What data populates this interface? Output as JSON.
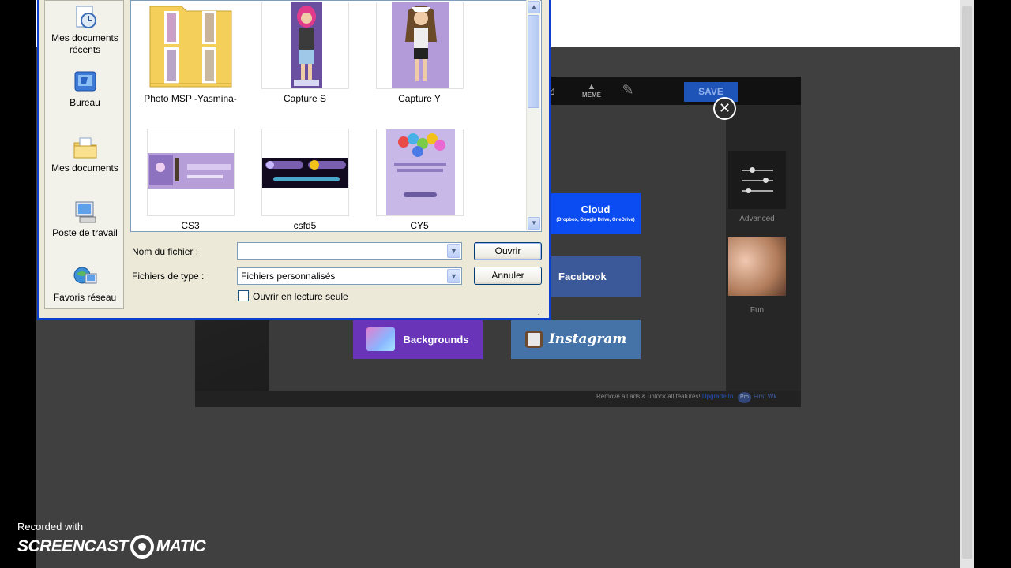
{
  "dialog": {
    "places": [
      {
        "label": "Mes documents récents",
        "icon": "recent-documents-icon"
      },
      {
        "label": "Bureau",
        "icon": "desktop-icon"
      },
      {
        "label": "Mes documents",
        "icon": "my-documents-icon"
      },
      {
        "label": "Poste de travail",
        "icon": "my-computer-icon"
      },
      {
        "label": "Favoris réseau",
        "icon": "network-places-icon"
      }
    ],
    "files": [
      {
        "name": "Photo MSP -Yasmina-",
        "kind": "folder"
      },
      {
        "name": "Capture S",
        "kind": "image"
      },
      {
        "name": "Capture Y",
        "kind": "image"
      },
      {
        "name": "CS3",
        "kind": "image"
      },
      {
        "name": "csfd5",
        "kind": "image"
      },
      {
        "name": "CY5",
        "kind": "image"
      }
    ],
    "filename_label": "Nom du fichier :",
    "filename_value": "",
    "filetype_label": "Fichiers de type :",
    "filetype_value": "Fichiers personnalisés",
    "open_label": "Ouvrir",
    "cancel_label": "Annuler",
    "readonly_label": "Ouvrir en lecture seule"
  },
  "editor": {
    "toolbar": {
      "meme_label": "MEME",
      "save_label": "SAVE"
    },
    "sources": {
      "cloud_label": "Cloud",
      "cloud_sub": "(Dropbox, Google Drive, OneDrive)",
      "facebook_label": "Facebook",
      "backgrounds_label": "Backgrounds",
      "instagram_label": "Instagram"
    },
    "panel": {
      "advanced_label": "Advanced",
      "fun_label": "Fun"
    },
    "footer": {
      "text": "Remove all ads & unlock all features!",
      "upgrade": "Upgrade to",
      "pro_badge": "Pro",
      "pro_text": "First Wk"
    }
  },
  "watermark": {
    "recorded_with": "Recorded with",
    "brand_left": "SCREENCAST",
    "brand_right": "MATIC"
  },
  "colors": {
    "xp_blue": "#0a3fd0",
    "cloud": "#0a4cf2",
    "facebook": "#3b5998",
    "backgrounds": "#6a34b9",
    "instagram": "#4573a8",
    "save": "#1e53b8"
  }
}
